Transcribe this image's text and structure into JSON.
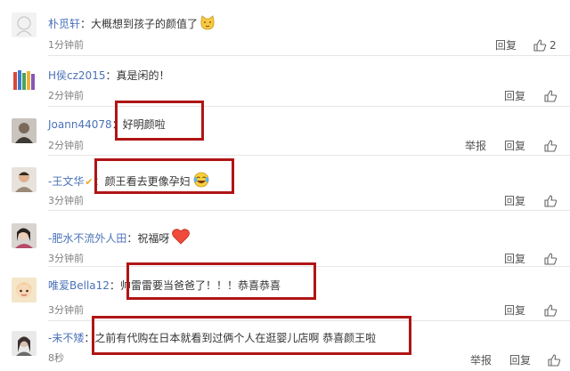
{
  "comments": [
    {
      "username": "朴觅轩",
      "separator": "：",
      "text": "大概想到孩子的颜值了",
      "emoji": "cat-face-emoji",
      "time": "1分钟前",
      "reply": "回复",
      "like_count": "2"
    },
    {
      "username": "H侯cz2015",
      "separator": "：",
      "text": "真是闲的！",
      "time": "2分钟前",
      "reply": "回复"
    },
    {
      "username": "Joann44078",
      "separator": "：",
      "text": "好明颜啦",
      "time": "2分钟前",
      "report": "举报",
      "reply": "回复"
    },
    {
      "username": "-王文华",
      "separator": "：",
      "text": "颜王看去更像孕妇",
      "emoji": "laughing-tears-emoji",
      "time": "3分钟前",
      "reply": "回复"
    },
    {
      "username": "-肥水不流外人田",
      "separator": "：",
      "text": "祝福呀",
      "emoji": "heart-emoji",
      "time": "3分钟前",
      "reply": "回复"
    },
    {
      "username": "唯爱Bella12",
      "separator": "：",
      "text": "帅雷雷要当爸爸了！！！恭喜恭喜",
      "time": "3分钟前",
      "reply": "回复"
    },
    {
      "username": "-未不矮",
      "separator": "：",
      "text": "之前有代购在日本就看到过俩个人在逛婴儿店啊 恭喜颜王啦",
      "time": "8秒",
      "report": "举报",
      "reply": "回复"
    }
  ],
  "colors": {
    "username": "#4b72b8",
    "highlight": "#b01515",
    "badge": "#f5a623"
  }
}
